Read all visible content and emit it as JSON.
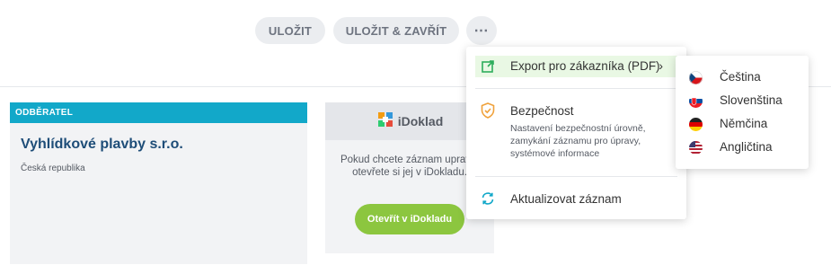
{
  "toolbar": {
    "save_label": "ULOŽIT",
    "save_close_label": "ULOŽIT & ZAVŘÍT",
    "more_label": "⋯"
  },
  "customer": {
    "header": "ODBĚRATEL",
    "name": "Vyhlídkové plavby s.r.o.",
    "country": "Česká republika"
  },
  "idoklad": {
    "logo_text": "iDoklad",
    "description": "Pokud chcete záznam upravit, otevřete si jej v iDokladu.",
    "open_button": "Otevřít v iDokladu"
  },
  "menu": {
    "export_label": "Export pro zákazníka (PDF)",
    "security_label": "Bezpečnost",
    "security_desc": "Nastavení bezpečnostní úrovně, zamykání záznamu pro úpravy, systémové informace",
    "update_label": "Aktualizovat záznam"
  },
  "languages": [
    {
      "label": "Čeština",
      "icon": "flag-cz-icon"
    },
    {
      "label": "Slovenština",
      "icon": "flag-sk-icon"
    },
    {
      "label": "Němčina",
      "icon": "flag-de-icon"
    },
    {
      "label": "Angličtina",
      "icon": "flag-us-icon"
    }
  ],
  "colors": {
    "accent_teal": "#12a8c9",
    "green": "#8cc63f",
    "customer_name": "#1e4d78",
    "export_highlight": "#e9f8e4"
  }
}
